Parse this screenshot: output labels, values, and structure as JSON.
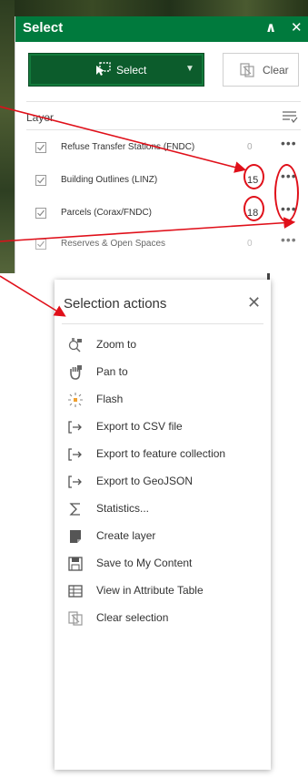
{
  "panel": {
    "title": "Select",
    "collapse_icon": "double-chevron-up-icon",
    "close_icon": "close-icon",
    "select_button": {
      "label": "Select",
      "icon": "select-cursor-icon",
      "caret": "chevron-down-icon"
    },
    "clear_button": {
      "label": "Clear",
      "icon": "clear-selection-icon"
    },
    "layer_heading": "Layer",
    "filter_icon": "filter-list-icon",
    "accent_color": "#007a3d",
    "layers": [
      {
        "name": "Refuse Transfer Stations (FNDC)",
        "count": "0",
        "checked": true
      },
      {
        "name": "Building Outlines (LINZ)",
        "count": "15",
        "checked": true
      },
      {
        "name": "Parcels (Corax/FNDC)",
        "count": "18",
        "checked": true
      },
      {
        "name": "Reserves & Open Spaces",
        "count": "0",
        "checked": true
      }
    ]
  },
  "popup": {
    "title": "Selection actions",
    "close_icon": "close-icon",
    "actions": [
      {
        "label": "Zoom to",
        "icon": "zoom-to-icon"
      },
      {
        "label": "Pan to",
        "icon": "pan-hand-icon"
      },
      {
        "label": "Flash",
        "icon": "flash-icon"
      },
      {
        "label": "Export to CSV file",
        "icon": "export-icon"
      },
      {
        "label": "Export to feature collection",
        "icon": "export-icon"
      },
      {
        "label": "Export to GeoJSON",
        "icon": "export-icon"
      },
      {
        "label": "Statistics...",
        "icon": "sigma-icon"
      },
      {
        "label": "Create layer",
        "icon": "create-layer-icon"
      },
      {
        "label": "Save to My Content",
        "icon": "save-icon"
      },
      {
        "label": "View in Attribute Table",
        "icon": "table-icon"
      },
      {
        "label": "Clear selection",
        "icon": "clear-selection-icon"
      }
    ]
  },
  "annotation_color": "#e0101a"
}
